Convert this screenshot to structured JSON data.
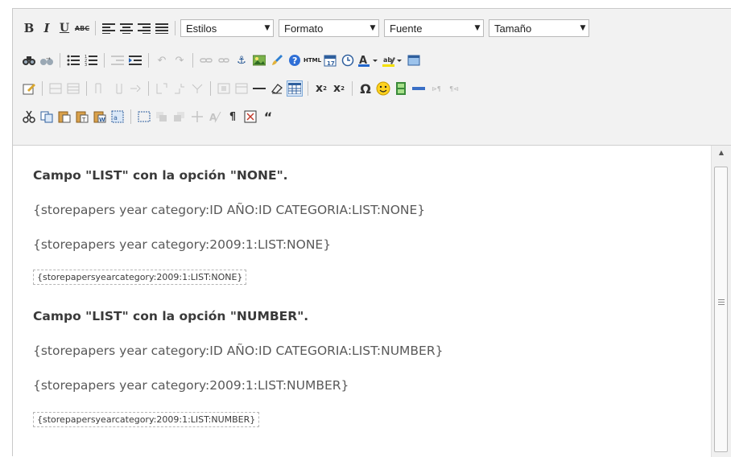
{
  "toolbar": {
    "row1": {
      "bold": "B",
      "italic": "I",
      "underline": "U",
      "strike": "ABC",
      "combos": {
        "styles": "Estilos",
        "format": "Formato",
        "font": "Fuente",
        "size": "Tamaño"
      }
    },
    "html_label": "HTML",
    "subscript": "x",
    "superscript": "x",
    "omega": "Ω",
    "pilcrow": "¶",
    "quote": "“"
  },
  "content": {
    "lines": [
      "Campo \"LIST\" con la opción \"NONE\".",
      "{storepapers year category:ID AÑO:ID CATEGORIA:LIST:NONE}",
      "{storepapers year category:2009:1:LIST:NONE}",
      "{storepapersyearcategory:2009:1:LIST:NONE}",
      "Campo \"LIST\" con la opción \"NUMBER\".",
      "{storepapers year category:ID AÑO:ID CATEGORIA:LIST:NUMBER}",
      "{storepapers year category:2009:1:LIST:NUMBER}",
      "{storepapersyearcategory:2009:1:LIST:NUMBER}"
    ]
  }
}
